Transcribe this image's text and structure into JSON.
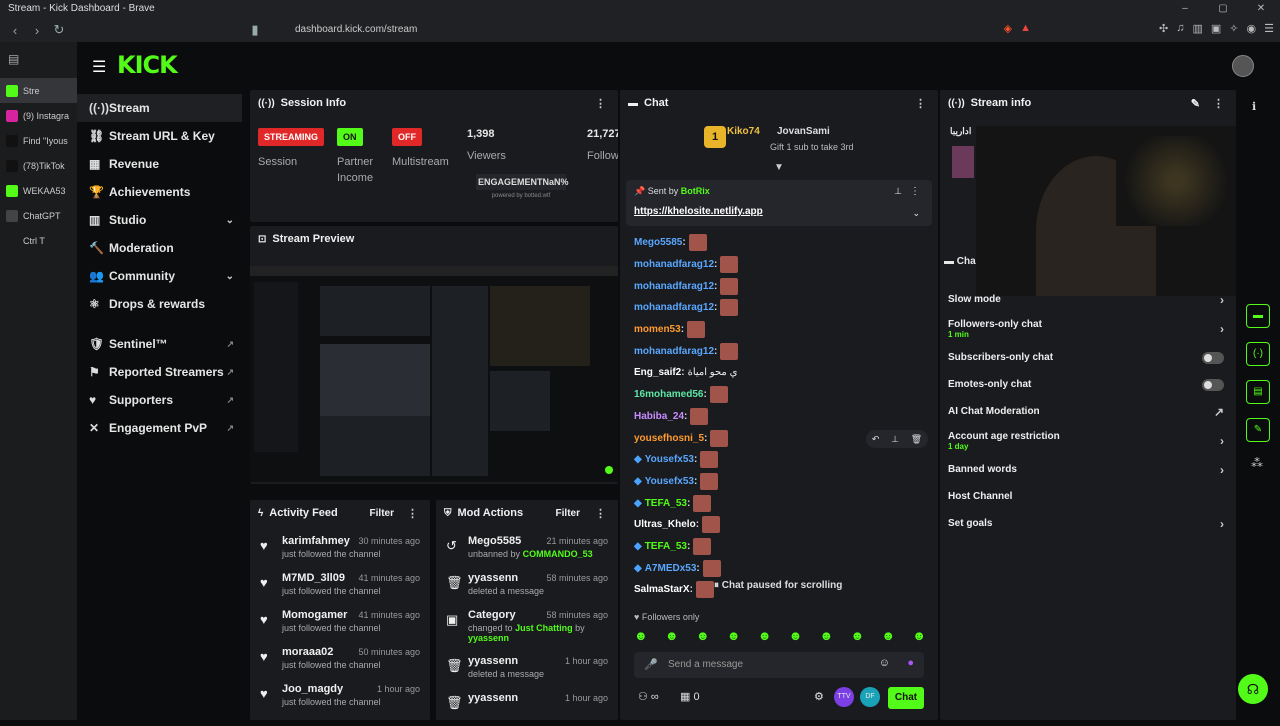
{
  "browser": {
    "title": "Stream - Kick Dashboard - Brave",
    "url": "dashboard.kick.com/stream"
  },
  "tabs": [
    {
      "label": "Stre",
      "color": "#53fc18"
    },
    {
      "label": "(9) Instagra",
      "color": "#d6249f"
    },
    {
      "label": "Find \"Iyous",
      "color": "#111"
    },
    {
      "label": "(78)TikTok",
      "color": "#111"
    },
    {
      "label": "WEKAA53",
      "color": "#53fc18"
    },
    {
      "label": "ChatGPT",
      "color": "#444"
    },
    {
      "label": "Ctrl T",
      "color": "#1b1c1e"
    }
  ],
  "app": {
    "logo": "KICK"
  },
  "sidebar": {
    "items": [
      {
        "label": "Stream",
        "icon": "broadcast-icon"
      },
      {
        "label": "Stream URL & Key",
        "icon": "link-icon"
      },
      {
        "label": "Revenue",
        "icon": "revenue-icon"
      },
      {
        "label": "Achievements",
        "icon": "trophy-icon"
      },
      {
        "label": "Studio",
        "icon": "studio-icon"
      },
      {
        "label": "Moderation",
        "icon": "hammer-icon"
      },
      {
        "label": "Community",
        "icon": "people-icon"
      },
      {
        "label": "Drops & rewards",
        "icon": "drops-icon"
      }
    ],
    "extra": [
      {
        "label": "Sentinel™"
      },
      {
        "label": "Reported Streamers"
      },
      {
        "label": "Supporters"
      },
      {
        "label": "Engagement PvP"
      }
    ]
  },
  "session": {
    "title": "Session Info",
    "streaming": "STREAMING",
    "session_label": "Session",
    "partner_badge": "ON",
    "partner_label": "Partner",
    "partner_label2": "Income",
    "multistream_badge": "OFF",
    "multistream_label": "Multistream",
    "viewers": "1,398",
    "viewers_label": "Viewers",
    "follows": "21,727",
    "follows_label": "Follow",
    "engagement": "ENGAGEMENTNaN%",
    "engagement_sub": "powered by botted.wtf"
  },
  "preview": {
    "title": "Stream Preview"
  },
  "activity": {
    "title": "Activity Feed",
    "filter": "Filter",
    "items": [
      {
        "name": "karimfahmey",
        "action": "just followed the channel",
        "time": "30 minutes ago"
      },
      {
        "name": "M7MD_3ll09",
        "action": "just followed the channel",
        "time": "41 minutes ago"
      },
      {
        "name": "Momogamer",
        "action": "just followed the channel",
        "time": "41 minutes ago"
      },
      {
        "name": "moraaa02",
        "action": "just followed the channel",
        "time": "50 minutes ago"
      },
      {
        "name": "Joo_magdy",
        "action": "just followed the channel",
        "time": "1 hour ago"
      }
    ]
  },
  "mod": {
    "title": "Mod Actions",
    "filter": "Filter",
    "items": [
      {
        "name": "Mego5585",
        "action": "unbanned by",
        "by": "COMMANDO_53",
        "time": "21 minutes ago"
      },
      {
        "name": "yyassenn",
        "action": "deleted a message",
        "by": "",
        "time": "58 minutes ago"
      },
      {
        "name": "Category",
        "action": "changed to",
        "by": "Just Chatting",
        "by2": "yyassenn",
        "time": "58 minutes ago"
      },
      {
        "name": "yyassenn",
        "action": "deleted a message",
        "by": "",
        "time": "1 hour ago"
      },
      {
        "name": "yyassenn",
        "action": "",
        "by": "",
        "time": "1 hour ago"
      }
    ]
  },
  "chat": {
    "title": "Chat",
    "leader1": "Kiko74",
    "leader1_count": "1",
    "leader2": "JovanSami",
    "leader2_count": "1",
    "gift_text": "Gift 1 sub to take 3rd",
    "pinned_label": "Sent by",
    "pinned_user": "BotRix",
    "pinned_link": "https://khelosite.netlify.app",
    "messages": [
      {
        "user": "Mego5585",
        "color": "#5aa7ff"
      },
      {
        "user": "mohanadfarag12",
        "color": "#5aa7ff"
      },
      {
        "user": "mohanadfarag12",
        "color": "#5aa7ff"
      },
      {
        "user": "mohanadfarag12",
        "color": "#5aa7ff"
      },
      {
        "user": "momen53",
        "color": "#ff9a2e"
      },
      {
        "user": "mohanadfarag12",
        "color": "#5aa7ff"
      },
      {
        "user": "Eng_saif2",
        "color": "#ffffff",
        "text": "ي محو امياة"
      },
      {
        "user": "16mohamed56",
        "color": "#5de6a6"
      },
      {
        "user": "Habiba_24",
        "color": "#c98cff"
      },
      {
        "user": "yousefhosni_5",
        "color": "#ff9a2e"
      },
      {
        "user": "Yousefx53",
        "color": "#5aa7ff"
      },
      {
        "user": "Yousefx53",
        "color": "#5aa7ff"
      },
      {
        "user": "TEFA_53",
        "color": "#53fc18"
      },
      {
        "user": "Ultras_Khelo",
        "color": "#ffffff"
      },
      {
        "user": "TEFA_53",
        "color": "#53fc18"
      },
      {
        "user": "A7MEDx53",
        "color": "#5aa7ff"
      },
      {
        "user": "SalmaStarX",
        "color": "#ffffff"
      }
    ],
    "paused": "Chat paused for scrolling",
    "followers_only": "Followers only",
    "placeholder": "Send a message",
    "count": "0",
    "send": "Chat"
  },
  "streaminfo": {
    "title": "Stream info",
    "chat_settings_title": "Cha",
    "settings": [
      {
        "label": "Slow mode",
        "sub": "",
        "control": "chevron"
      },
      {
        "label": "Followers-only chat",
        "sub": "1 min",
        "control": "chevron"
      },
      {
        "label": "Subscribers-only chat",
        "sub": "",
        "control": "toggle"
      },
      {
        "label": "Emotes-only chat",
        "sub": "",
        "control": "toggle"
      },
      {
        "label": "AI Chat Moderation",
        "sub": "",
        "control": "external"
      },
      {
        "label": "Account age restriction",
        "sub": "1 day",
        "control": "chevron"
      },
      {
        "label": "Banned words",
        "sub": "",
        "control": "chevron"
      },
      {
        "label": "Host Channel",
        "sub": "",
        "control": "none"
      },
      {
        "label": "Set goals",
        "sub": "",
        "control": "chevron"
      }
    ],
    "arabic_title": "اداريبا"
  },
  "colors": {
    "accent": "#53fc18",
    "streaming": "#e02828",
    "panel": "#191b1f"
  }
}
